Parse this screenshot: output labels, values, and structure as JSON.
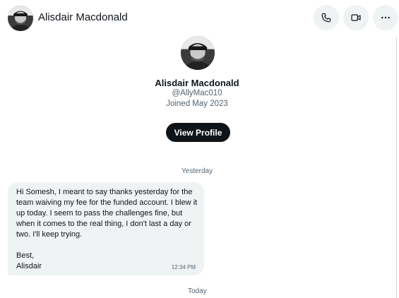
{
  "header": {
    "name": "Alisdair Macdonald",
    "call_icon": "phone-icon",
    "video_icon": "video-camera-icon",
    "more_icon": "more-horizontal-icon"
  },
  "profile": {
    "name": "Alisdair Macdonald",
    "handle": "@AllyMac010",
    "joined": "Joined May 2023",
    "view_profile_label": "View Profile"
  },
  "conversation": {
    "day_labels": [
      "Yesterday",
      "Today"
    ],
    "messages": [
      {
        "text": "Hi Somesh, I meant to say thanks yesterday for the team waiving my fee for the funded account. I blew it up today. I seem to pass the challenges fine, but when it comes to the real thing, I don't last a day or two. I'll keep trying.\n\nBest,\nAlisdair",
        "time": "12:34 PM"
      }
    ]
  },
  "colors": {
    "text_primary": "#0f1419",
    "text_secondary": "#536471",
    "button_dark": "#0f1419",
    "bubble_bg": "#eff3f4"
  }
}
